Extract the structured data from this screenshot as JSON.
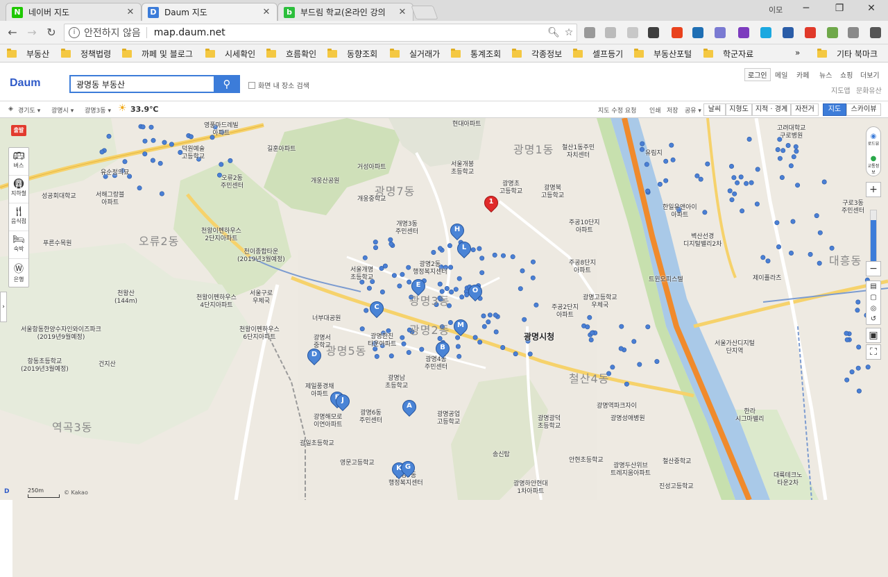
{
  "browser": {
    "tabs": [
      {
        "title": "네이버 지도",
        "favicon": "N",
        "color": "#1ec800"
      },
      {
        "title": "Daum 지도",
        "favicon": "D",
        "color": "#3c7cd9"
      },
      {
        "title": "부드림 학교(온라인 강의",
        "favicon": "b",
        "color": "#2cbf3c"
      }
    ],
    "user": "이모",
    "insecure_label": "안전하지 않음",
    "url": "map.daum.net",
    "ext_colors": [
      "#999999",
      "#bbbbbb",
      "#c8c8c8",
      "#3f3f3f",
      "#e9421d",
      "#1f6fb4",
      "#7a7ad2",
      "#7d3cbe",
      "#1ba8e0",
      "#2b5da8",
      "#e0392a",
      "#6fa84a",
      "#8a8a8a",
      "#555555"
    ],
    "bookmarks": [
      "부동산",
      "정책법령",
      "까페 및 블로그",
      "시세확인",
      "흐름확인",
      "동향조회",
      "실거래가",
      "통계조회",
      "각종정보",
      "셀프등기",
      "부동산포털",
      "학군자료"
    ],
    "bookmarks_more": "»",
    "bookmarks_other": "기타 북마크"
  },
  "daum": {
    "logo": "Daum",
    "logo_suffix": "지도",
    "search_value": "광명동 부동산",
    "search_icon": "search-icon",
    "in_screen_label": "화면 내 장소 검색",
    "login": "로그인",
    "services": [
      "메일",
      "카페",
      "뉴스",
      "쇼핑",
      "더보기"
    ],
    "services2": [
      "지도앱",
      "문화유산"
    ]
  },
  "toolbar": {
    "region1": "경기도",
    "region2": "광명시",
    "region3": "광명3동",
    "weather_icon": "sun-icon",
    "temperature": "33.9℃",
    "links": [
      "지도 수정 요청",
      "인쇄",
      "저장",
      "공유"
    ],
    "layer_buttons": [
      "날씨",
      "지형도",
      "지적 · 경계",
      "자전거"
    ],
    "view_buttons": [
      "지도",
      "스카이뷰"
    ],
    "active_view": "지도"
  },
  "side_panel": {
    "depart": "출발",
    "items": [
      {
        "icon": "bus-icon",
        "label": "버스"
      },
      {
        "icon": "subway-icon",
        "label": "지하철"
      },
      {
        "icon": "restaurant-icon",
        "label": "음식점"
      },
      {
        "icon": "hotel-icon",
        "label": "숙박"
      },
      {
        "icon": "bank-icon",
        "label": "은행"
      }
    ]
  },
  "right_controls": {
    "roadview": "로드뷰",
    "traffic": "교통정보",
    "zoom_in": "+",
    "zoom_out": "−"
  },
  "map": {
    "scale": "250m",
    "copyright": "© Kakao",
    "area_labels": [
      "오류2동",
      "광명7동",
      "광명1동",
      "광명5동",
      "철산4동",
      "대흥동",
      "역곡3동",
      "광명3동",
      "광명2동"
    ],
    "places": [
      {
        "t": "천왕이펜하우스\n2단지아파트"
      },
      {
        "t": "천이종합타운\n(2019년3월예정)"
      },
      {
        "t": "서울개명\n초등학교"
      },
      {
        "t": "개명3동\n주민센터"
      },
      {
        "t": "광명2동\n행정복지센터"
      },
      {
        "t": "천왕산\n(144m)"
      },
      {
        "t": "서울항동한양수자인와이즈파크\n(2019년9월예정)"
      },
      {
        "t": "항동초등학교\n(2019년3월예정)"
      },
      {
        "t": "건지산"
      },
      {
        "t": "광명서\n중학교"
      },
      {
        "t": "광명한진\n타운아파트"
      },
      {
        "t": "광명4동\n주민센터"
      },
      {
        "t": "광명남\n초등학교"
      },
      {
        "t": "광명시청"
      },
      {
        "t": "광명6동\n주민센터"
      },
      {
        "t": "광명공업\n고등학교"
      },
      {
        "t": "광명광덕\n초등학교"
      },
      {
        "t": "광명성애병원"
      },
      {
        "t": "철산중학교"
      },
      {
        "t": "서울가산디지털\n단지역"
      },
      {
        "t": "한라\n시그마밸리"
      },
      {
        "t": "대륙테크노\n타운2차"
      },
      {
        "t": "구로3동\n주민센터"
      },
      {
        "t": "고려대학교\n구로병원"
      },
      {
        "t": "유림지"
      },
      {
        "t": "한일유앤아이\n아파트"
      },
      {
        "t": "벽산선경\n디지털밸리2차"
      },
      {
        "t": "트윈오피스텔"
      },
      {
        "t": "제이플라츠"
      },
      {
        "t": "현대아파트"
      },
      {
        "t": "서울개봉\n초등학교"
      },
      {
        "t": "광명초\n고등학교"
      },
      {
        "t": "철산1동주민\n자치센터"
      },
      {
        "t": "광명북\n고등학교"
      },
      {
        "t": "주공10단지\n아파트"
      },
      {
        "t": "주공8단지\n아파트"
      },
      {
        "t": "주공2단지\n아파트"
      },
      {
        "t": "광명고등학교\n우체국"
      },
      {
        "t": "안현초등학교"
      },
      {
        "t": "광명두산위브\n트레지움아파트"
      },
      {
        "t": "진성고등학교"
      },
      {
        "t": "제일풍경채\n아파트"
      },
      {
        "t": "광명해모로\n이연아파트"
      },
      {
        "t": "영문고등학교"
      },
      {
        "t": "광일초등학교"
      },
      {
        "t": "서울구로\n우체국"
      },
      {
        "t": "천왕이펜하우스\n6단지아파트"
      },
      {
        "t": "천왕이펜하우스\n4단지아파트"
      },
      {
        "t": "너부대공원"
      },
      {
        "t": "개웅산공원"
      },
      {
        "t": "개웅중학교"
      },
      {
        "t": "거성아파트"
      },
      {
        "t": "길훈아파트"
      },
      {
        "t": "오류2동\n주민센터"
      },
      {
        "t": "덕원예술\n고등학교"
      },
      {
        "t": "유순정의묘"
      },
      {
        "t": "서해그랑블\n아파트"
      },
      {
        "t": "성공회대학교"
      },
      {
        "t": "푸른수목원"
      },
      {
        "t": "영풍마드레빌\n아파트"
      },
      {
        "t": "송신탑"
      },
      {
        "t": "광명5동\n행정복지센터"
      },
      {
        "t": "광명하안현대\n1차아파트"
      },
      {
        "t": "광명역파크자이"
      }
    ],
    "markers": [
      "1",
      "H",
      "L",
      "E",
      "O",
      "C",
      "M",
      "B",
      "D",
      "F",
      "J",
      "A",
      "K",
      "G"
    ]
  }
}
